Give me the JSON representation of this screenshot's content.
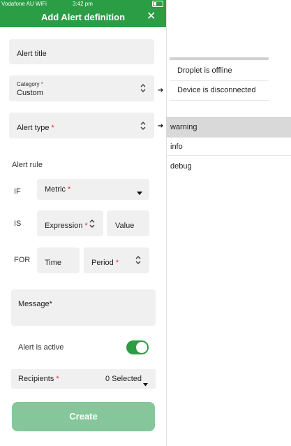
{
  "status_bar": {
    "carrier": "Vodafone AU WiFi",
    "time": "3:42 pm"
  },
  "header": {
    "title": "Add Alert definition",
    "close_glyph": "✕"
  },
  "form": {
    "alert_title_placeholder": "Alert title",
    "category_label": "Category",
    "category_value": "Custom",
    "alert_type_label": "Alert type",
    "alert_rule_heading": "Alert rule",
    "if_label": "IF",
    "metric_label": "Metric",
    "is_label": "IS",
    "expression_label": "Expression",
    "value_placeholder": "Value",
    "for_label": "FOR",
    "time_placeholder": "Time",
    "period_label": "Period",
    "message_label": "Message*",
    "alert_active_label": "Alert is active",
    "alert_active": true,
    "recipients_label": "Recipients",
    "recipients_value": "0 Selected",
    "create_label": "Create",
    "required_mark": "*"
  },
  "category_options": [
    "Droplet is offline",
    "Device is disconnected"
  ],
  "alert_type_options": [
    "warning",
    "info",
    "debug"
  ],
  "alert_type_highlighted": "warning",
  "arrow_glyph": "➔",
  "colors": {
    "brand_green": "#2a9d45",
    "create_disabled": "#85c79a",
    "required": "#d33333"
  }
}
